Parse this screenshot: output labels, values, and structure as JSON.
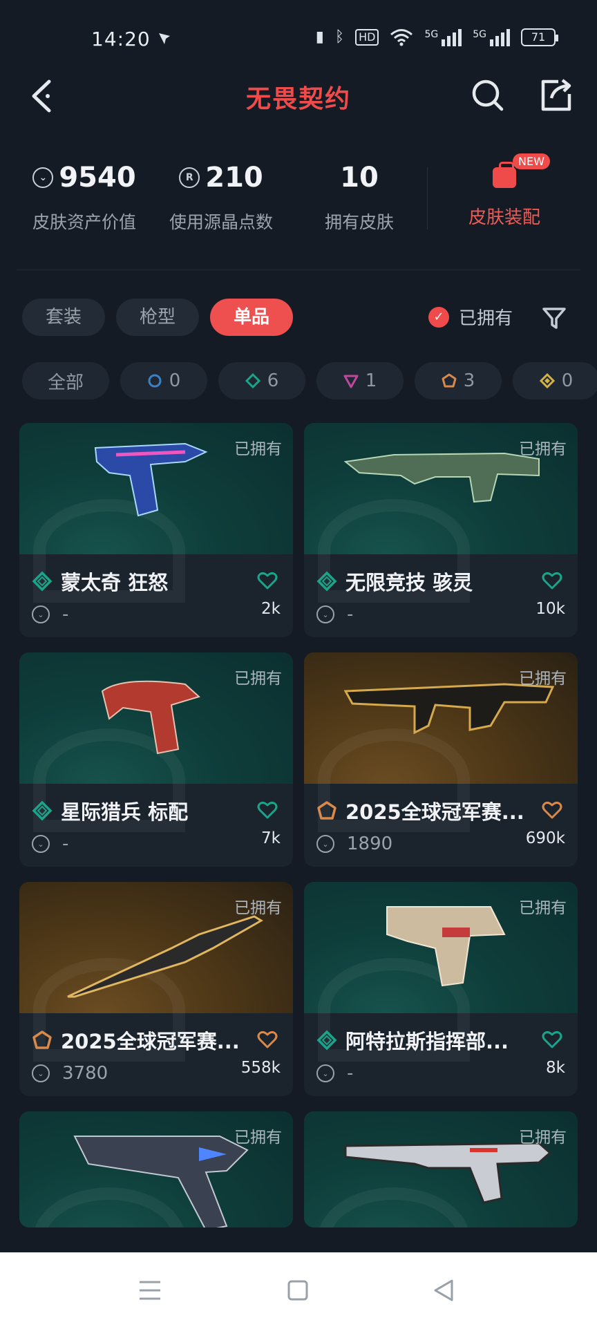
{
  "status_bar": {
    "time": "14:20",
    "network_1": "5G",
    "network_2": "5G",
    "hd_label": "HD",
    "battery": "71"
  },
  "header": {
    "title": "无畏契约"
  },
  "stats": [
    {
      "value": "9540",
      "label": "皮肤资产价值",
      "icon": "vp-coin-icon"
    },
    {
      "value": "210",
      "label": "使用源晶点数",
      "icon": "radianite-icon"
    },
    {
      "value": "10",
      "label": "拥有皮肤",
      "icon": ""
    }
  ],
  "equip": {
    "label": "皮肤装配",
    "badge": "NEW"
  },
  "tabs": [
    {
      "label": "套装",
      "active": false
    },
    {
      "label": "枪型",
      "active": false
    },
    {
      "label": "单品",
      "active": true
    }
  ],
  "owned_filter": {
    "label": "已拥有",
    "checked": true
  },
  "rarity_filters": [
    {
      "label": "全部"
    },
    {
      "count": "0",
      "color": "#3b82c4",
      "icon": "select-tier-icon"
    },
    {
      "count": "6",
      "color": "#1aa48a",
      "icon": "deluxe-tier-icon"
    },
    {
      "count": "1",
      "color": "#c0489c",
      "icon": "premium-tier-icon"
    },
    {
      "count": "3",
      "color": "#d98a4a",
      "icon": "exclusive-tier-icon"
    },
    {
      "count": "0",
      "color": "#d4b24a",
      "icon": "ultra-tier-icon"
    }
  ],
  "cards": [
    {
      "name": "蒙太奇 狂怒",
      "price": "-",
      "likes": "2k",
      "owned": "已拥有",
      "tier_color": "#1aa48a",
      "bg": "teal"
    },
    {
      "name": "无限竞技 骇灵",
      "price": "-",
      "likes": "10k",
      "owned": "已拥有",
      "tier_color": "#1aa48a",
      "bg": "teal"
    },
    {
      "name": "星际猎兵 标配",
      "price": "-",
      "likes": "7k",
      "owned": "已拥有",
      "tier_color": "#1aa48a",
      "bg": "teal"
    },
    {
      "name": "2025全球冠军赛...",
      "price": "1890",
      "likes": "690k",
      "owned": "已拥有",
      "tier_color": "#d98a4a",
      "bg": "gold"
    },
    {
      "name": "2025全球冠军赛...",
      "price": "3780",
      "likes": "558k",
      "owned": "已拥有",
      "tier_color": "#d98a4a",
      "bg": "gold"
    },
    {
      "name": "阿特拉斯指挥部...",
      "price": "-",
      "likes": "8k",
      "owned": "已拥有",
      "tier_color": "#1aa48a",
      "bg": "teal"
    },
    {
      "name": "",
      "price": "",
      "likes": "",
      "owned": "已拥有",
      "tier_color": "#1aa48a",
      "bg": "teal"
    },
    {
      "name": "",
      "price": "",
      "likes": "",
      "owned": "已拥有",
      "tier_color": "#1aa48a",
      "bg": "teal"
    }
  ],
  "colors": {
    "accent": "#ef4b4b",
    "background": "#141b24",
    "card": "#1b232d"
  }
}
